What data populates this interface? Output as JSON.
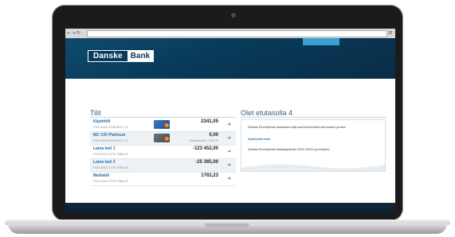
{
  "header": {
    "logo_left": "Danske",
    "logo_right": "Bank"
  },
  "accounts_section": {
    "title": "Tilit",
    "accounts": [
      {
        "name": "Käyttötili",
        "number": "FI41 8312 3238 5677 13",
        "balance": "2341,05",
        "available": "",
        "card": "blue",
        "shaded": false
      },
      {
        "name": "MC C/D Platinum",
        "number": "FI85 8316 8070 5677 21",
        "balance": "0,00",
        "available": "Käytettävissä: 5 000,00",
        "card": "grey",
        "shaded": true
      },
      {
        "name": "Laina koti 1",
        "number": "FI13 8312 0775 7566 03",
        "balance": "-123 452,00",
        "available": "",
        "card": "",
        "shaded": false
      },
      {
        "name": "Laina koti 2",
        "number": "FI13 8312 0775 7566 03",
        "balance": "-25 365,00",
        "available": "",
        "card": "",
        "shaded": true
      },
      {
        "name": "Matkatili",
        "number": "FI13 8312 0775 7566 03",
        "balance": "1763,23",
        "available": "",
        "card": "",
        "shaded": false
      }
    ]
  },
  "info_section": {
    "title": "Olet etutasolla 4",
    "text1": "Danske Etuohjelman etutasolla neljä saat erinomaiset etenoukset ja edut.",
    "link": "Hyödynnä etusi",
    "text2": "Danske Etuohjelman Asiakaspalvelu 0200 20101 (pvm/mpm)"
  }
}
